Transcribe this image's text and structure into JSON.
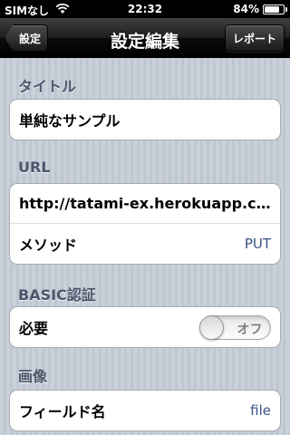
{
  "status_bar": {
    "carrier": "SIMなし",
    "time": "22:32",
    "battery": "84%",
    "battery_level": 0.84
  },
  "nav": {
    "back_label": "設定",
    "title": "設定編集",
    "report_label": "レポート"
  },
  "sections": {
    "title": {
      "header": "タイトル",
      "value": "単純なサンプル"
    },
    "url": {
      "header": "URL",
      "url_value": "http://tatami-ex.herokuapp.com/",
      "method_label": "メソッド",
      "method_value": "PUT"
    },
    "basic_auth": {
      "header": "BASIC認証",
      "required_label": "必要",
      "switch_state": "オフ"
    },
    "image": {
      "header": "画像",
      "field_name_label": "フィールド名",
      "field_name_value": "file"
    }
  }
}
